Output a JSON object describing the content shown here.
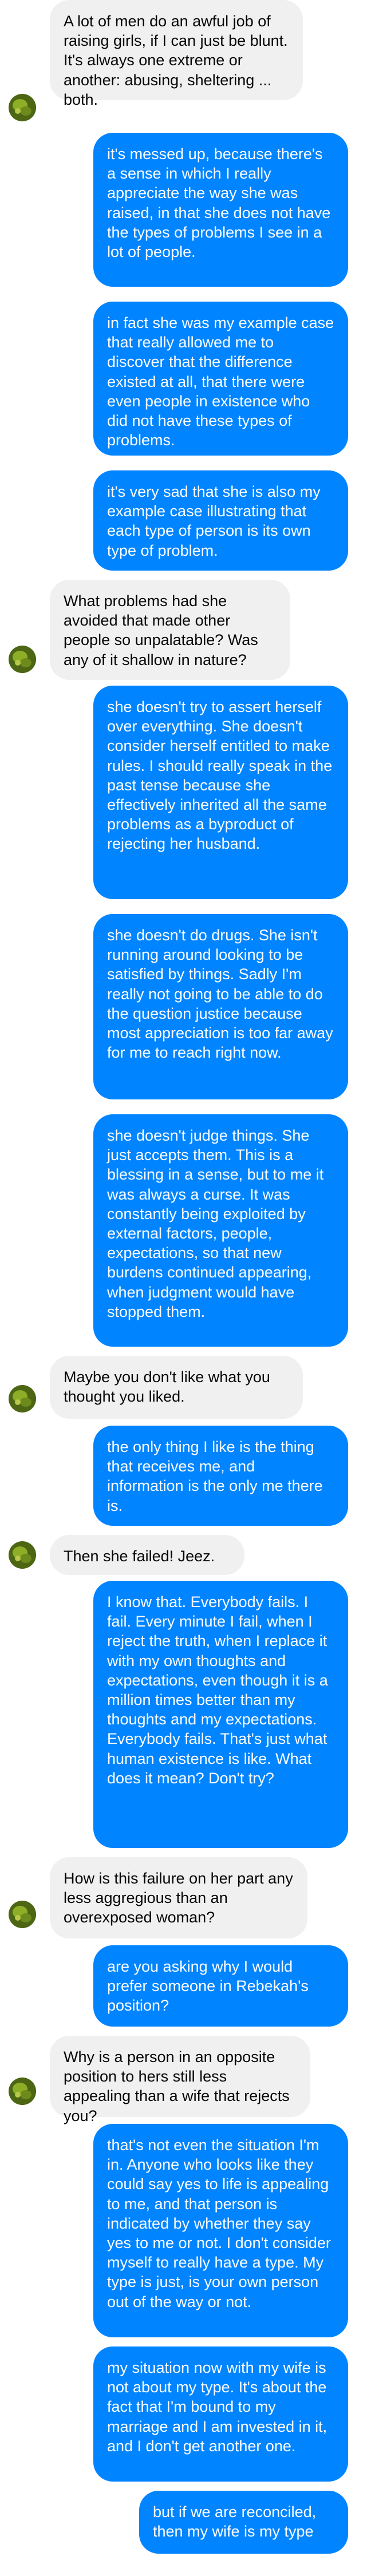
{
  "conversation": {
    "contact_avatar_icon": "contact-avatar-icon",
    "colors": {
      "incoming_bubble": "#f0f0f0",
      "incoming_text": "#050505",
      "outgoing_bubble": "#0084ff",
      "outgoing_text": "#ffffff",
      "avatar": "#5a7a18"
    },
    "messages": [
      {
        "direction": "incoming",
        "text": "A lot of men do an awful job of raising girls, if I can just be blunt. It's always one extreme or another: abusing, sheltering ... both."
      },
      {
        "direction": "outgoing",
        "text": "it's messed up, because there's a sense in which I really appreciate the way she was raised, in that she does not have the types of problems I see in a lot of people."
      },
      {
        "direction": "outgoing",
        "text": "in fact she was my example case that really allowed me to discover that the difference existed at all, that there were even people in existence who did not have these types of problems."
      },
      {
        "direction": "outgoing",
        "text": "it's very sad that she is also my example case illustrating that each type of person is its own type of problem."
      },
      {
        "direction": "incoming",
        "text": "What problems had she avoided that made other people so unpalatable? Was any of it shallow in nature?"
      },
      {
        "direction": "outgoing",
        "text": "she doesn't try to assert herself over everything. She doesn't consider herself entitled to make rules. I should really speak in the past tense because she effectively inherited all the same problems as a byproduct of rejecting her husband."
      },
      {
        "direction": "outgoing",
        "text": "she doesn't do drugs. She isn't running around looking to be satisfied by things. Sadly I'm really not going to be able to do the question justice because most appreciation is too far away for me to reach right now."
      },
      {
        "direction": "outgoing",
        "text": "she doesn't judge things. She just accepts them. This is a blessing in a sense, but to me it was always a curse. It was constantly being exploited by external factors, people, expectations, so that new burdens continued appearing, when judgment would have stopped them."
      },
      {
        "direction": "incoming",
        "text": "Maybe you don't like what you thought you liked."
      },
      {
        "direction": "outgoing",
        "text": "the only thing I like is the thing that receives me, and information is the only me there is."
      },
      {
        "direction": "incoming",
        "text": "Then she failed! Jeez."
      },
      {
        "direction": "outgoing",
        "text": "I know that. Everybody fails. I fail. Every minute I fail, when I reject the truth, when I replace it with my own thoughts and expectations, even though it is a million times better than my thoughts and my expectations. Everybody fails. That's just what human existence is like. What does it mean? Don't try?"
      },
      {
        "direction": "incoming",
        "text": "How is this failure on her part any less aggregious than an overexposed woman?"
      },
      {
        "direction": "outgoing",
        "text": "are you asking why I would prefer someone in Rebekah's position?"
      },
      {
        "direction": "incoming",
        "text": "Why is a person in an opposite position to hers still less appealing than a wife that rejects you?"
      },
      {
        "direction": "outgoing",
        "text": "that's not even the situation I'm in. Anyone who looks like they could say yes to life is appealing to me, and that person is indicated by whether they say yes to me or not. I don't consider myself to really have a type. My type is just, is your own person out of the way or not."
      },
      {
        "direction": "outgoing",
        "text": "my situation now with my wife is not about my type. It's about the fact that I'm bound to my marriage and I am invested in it, and I don't get another one."
      },
      {
        "direction": "outgoing",
        "text": "but if we are reconciled, then my wife is my type"
      }
    ]
  }
}
